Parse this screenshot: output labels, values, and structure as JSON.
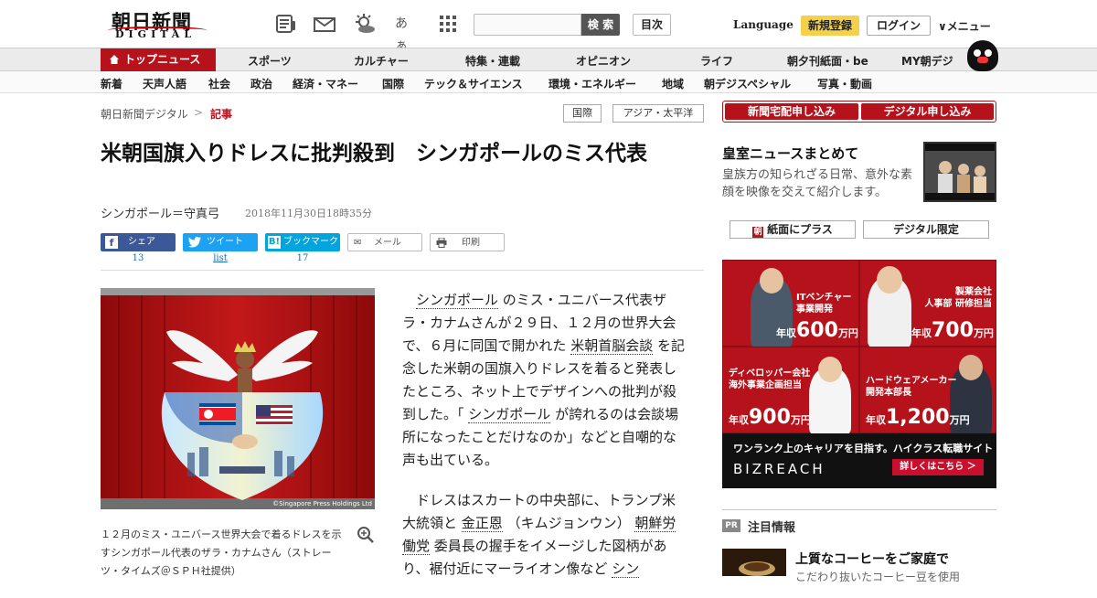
{
  "header": {
    "logo_jp": "朝日新聞",
    "logo_en": "DIGITAL",
    "icons": [
      "newspaper-icon",
      "mail-icon",
      "weather-icon",
      "font-size-icon",
      "grid-icon"
    ],
    "font_size_label": "あぁ",
    "search_placeholder": "",
    "search_button": "検 索",
    "toc_button": "目次",
    "language": "Language",
    "register_button": "新規登録",
    "login_button": "ログイン",
    "menu_button": "メニュー"
  },
  "nav_primary": [
    "トップニュース",
    "スポーツ",
    "カルチャー",
    "特集・連載",
    "オピニオン",
    "ライフ",
    "朝夕刊紙面・be",
    "MY朝デジ"
  ],
  "nav_secondary": [
    "新着",
    "天声人語",
    "社会",
    "政治",
    "経済・マネー",
    "国際",
    "テック＆サイエンス",
    "環境・エネルギー",
    "地域",
    "朝デジスペシャル",
    "写真・動画"
  ],
  "breadcrumb": {
    "home": "朝日新聞デジタル",
    "separator": ">",
    "current": "記事"
  },
  "tags": [
    "国際",
    "アジア・太平洋"
  ],
  "article": {
    "title": "米朝国旗入りドレスに批判殺到　シンガポールのミス代表",
    "byline": "シンガポール＝守真弓",
    "date": "2018年11月30日18時35分",
    "share": {
      "facebook_label": "シェア",
      "facebook_count": "13",
      "twitter_label": "ツイート",
      "twitter_count": "list",
      "hatena_label": "ブックマーク",
      "hatena_count": "17",
      "mail_label": "メール",
      "print_label": "印刷"
    },
    "photo_credit": "©Singapore Press Holdings Ltd",
    "caption": "１２月のミス・ユニバース世界大会で着るドレスを示すシンガポール代表のザラ・カナムさん（ストレーツ・タイムズ＠ＳＰＨ社提供）",
    "p1": {
      "k1": "シンガポール",
      "t1": "のミス・ユニバース代表ザラ・カナムさんが２９日、１２月の世界大会で、６月に同国で開かれた",
      "k2": "米朝首脳会談",
      "t2": "を記念した米朝の国旗入りドレスを着ると発表したところ、ネット上でデザインへの批判が殺到した。「",
      "k3": "シンガポール",
      "t3": "が誇れるのは会談場所になったことだけなのか」などと自嘲的な声も出ている。"
    },
    "p2": {
      "t1": "ドレスはスカートの中央部に、トランプ米大統領と",
      "k1": "金正恩",
      "t2": "（キムジョンウン）",
      "k2": "朝鮮労働党",
      "t3": "委員長の握手をイメージした図柄があり、裾付近にマーライオン像など",
      "k3": "シン"
    }
  },
  "sidebar": {
    "subscribe_paper": "新聞宅配申し込み",
    "subscribe_digital": "デジタル申し込み",
    "royal_title": "皇室ニュースまとめて",
    "royal_desc": "皇族方の知られざる日常、意外な素顔を映像を交えて紹介します。",
    "paper_plus": "紙面にプラス",
    "digital_only": "デジタル限定",
    "ad": {
      "cells": [
        {
          "title": "ITベンチャー\n事業開発",
          "pay_prefix": "年収",
          "pay": "600",
          "unit": "万円"
        },
        {
          "title": "製薬会社\n人事部 研修担当",
          "pay_prefix": "年収",
          "pay": "700",
          "unit": "万円"
        },
        {
          "title": "ディベロッパー会社\n海外事業企画担当",
          "pay_prefix": "年収",
          "pay": "900",
          "unit": "万円"
        },
        {
          "title": "ハードウェアメーカー\n開発本部長",
          "pay_prefix": "年収",
          "pay": "1,200",
          "unit": "万円"
        }
      ],
      "tagline": "ワンランク上のキャリアを目指す。ハイクラス転職サイト",
      "brand": "BIZREACH",
      "cta": "詳しくはこちら ＞"
    },
    "pr_badge": "PR",
    "pr_title": "注目情報",
    "pr_headline": "上質なコーヒーをご家庭で",
    "pr_sub": "こだわり抜いたコーヒー豆を使用"
  },
  "colors": {
    "brand_red": "#b5121b",
    "facebook": "#3b5998",
    "twitter": "#1da1f2",
    "hatena": "#00a4de",
    "register_yellow": "#f5d04a"
  }
}
